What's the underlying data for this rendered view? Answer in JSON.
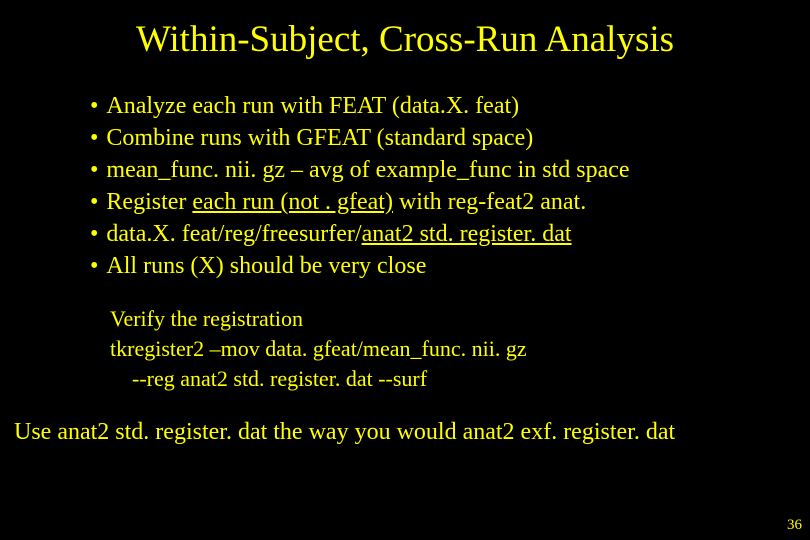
{
  "title": "Within-Subject, Cross-Run Analysis",
  "bullets": [
    "Analyze each run with FEAT (data.X. feat)",
    "Combine runs with GFEAT (standard space)",
    "mean_func. nii. gz – avg of example_func in std space",
    "",
    "",
    "All runs (X) should be very close"
  ],
  "bullet3_pre": "Register ",
  "bullet3_u": "each run (not . gfeat)",
  "bullet3_post": " with reg-feat2 anat.",
  "bullet4_pre": "data.X. feat/reg/freesurfer/",
  "bullet4_u": "anat2 std. register. dat",
  "sub": {
    "l1": "Verify the registration",
    "l2": "tkregister2 –mov data. gfeat/mean_func. nii. gz",
    "l3": "--reg anat2 std. register. dat --surf"
  },
  "footer": "Use anat2 std. register. dat the way you would anat2 exf. register. dat",
  "page": "36"
}
